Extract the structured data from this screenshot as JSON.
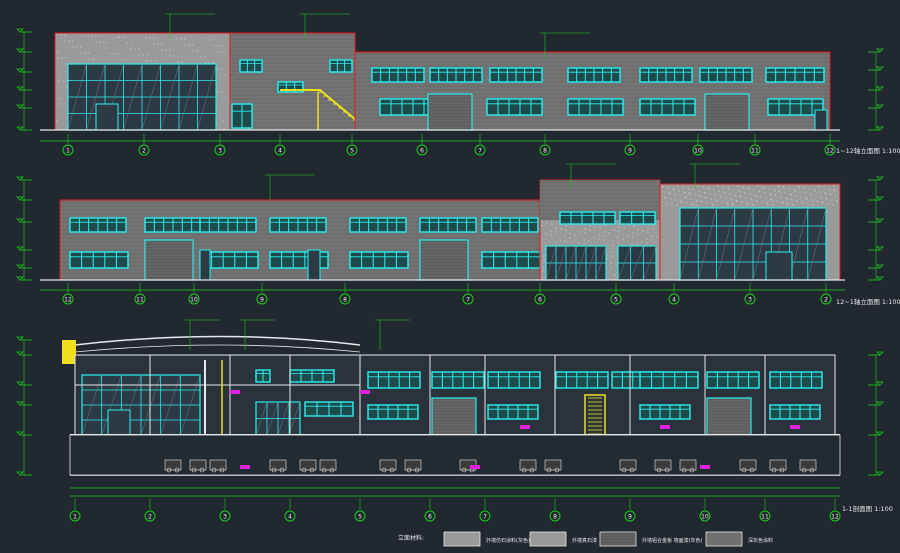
{
  "colors": {
    "background": "#212830",
    "wall_fill": "#6e6e6e",
    "cad_red": "#e01818",
    "cad_green": "#18d018",
    "cad_cyan": "#28f0f0",
    "cad_yellow": "#f0e01c",
    "cad_magenta": "#e020e0",
    "cad_white": "#e8e8e8",
    "stone_fill": "#9a9a9a",
    "dark_panel": "#585858"
  },
  "drawing": {
    "elevation_1_axes": [
      "1",
      "2",
      "3",
      "4",
      "5",
      "6",
      "7",
      "8",
      "9",
      "10",
      "11",
      "12"
    ],
    "elevation_1_title": "1~12轴立面图",
    "elevation_1_scale": "1:100",
    "elevation_2_axes": [
      "12",
      "11",
      "10",
      "9",
      "8",
      "7",
      "6",
      "5",
      "4",
      "3",
      "2",
      "1"
    ],
    "elevation_2_title": "12~1轴立面图",
    "elevation_2_scale": "1:100",
    "section_axes": [
      "1",
      "2",
      "3",
      "4",
      "5",
      "6",
      "7",
      "8",
      "9",
      "10",
      "11",
      "12"
    ],
    "section_title": "1-1剖面图",
    "section_scale": "1:100",
    "legend_label": "立面材料:",
    "legend_items": [
      "外墙仿石涂料(灰色)",
      "外墙真石漆",
      "外墙铝合金板 墙面漆(灰色)",
      "深灰色涂料"
    ]
  }
}
